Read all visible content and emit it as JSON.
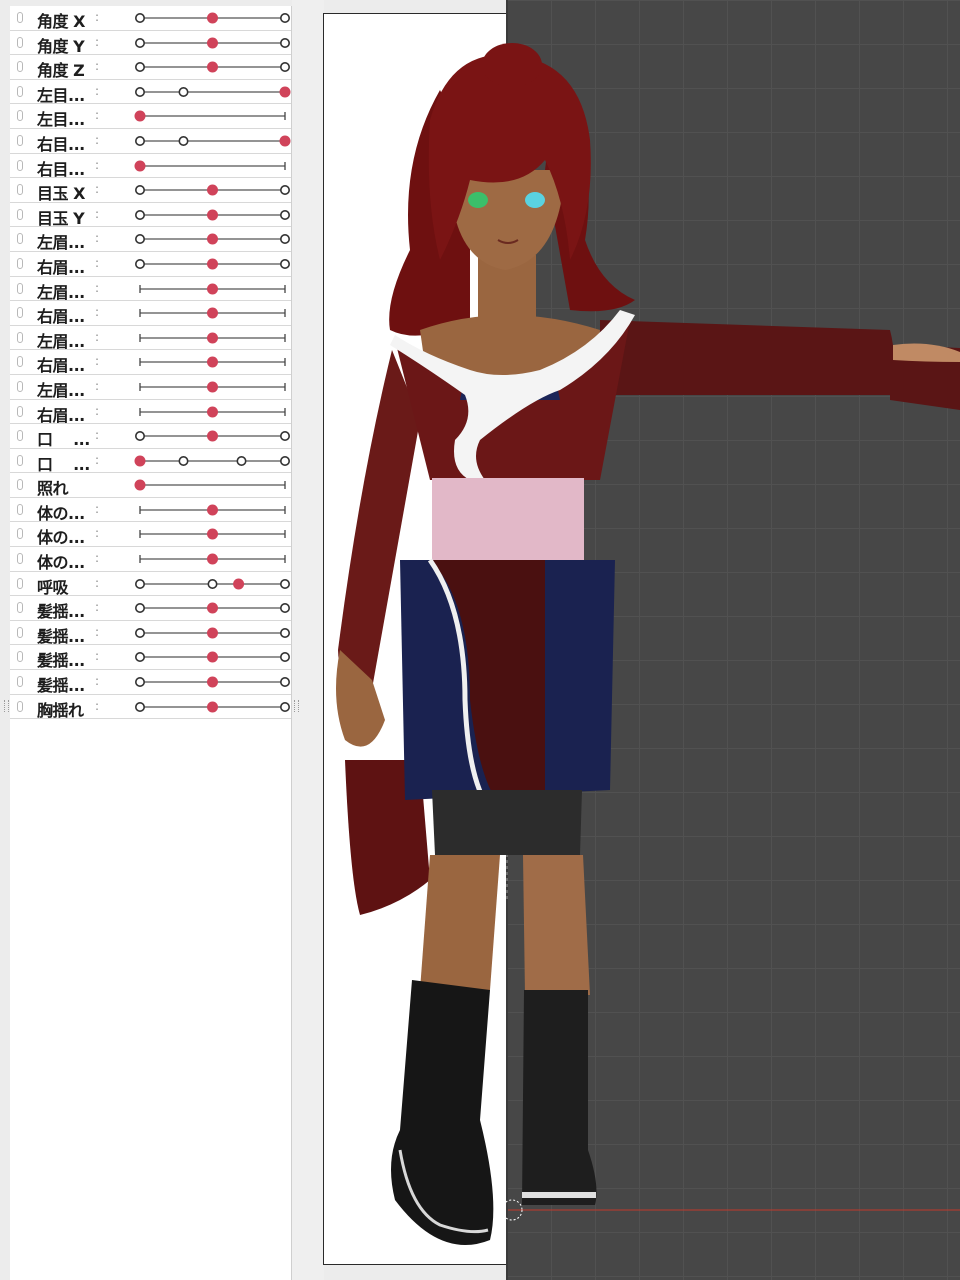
{
  "params": [
    {
      "name": "角度 X",
      "colon": ":",
      "style": "ends",
      "dots": [],
      "value": 0.5
    },
    {
      "name": "角度 Y",
      "colon": ":",
      "style": "ends",
      "dots": [],
      "value": 0.5
    },
    {
      "name": "角度 Z",
      "colon": ":",
      "style": "ends",
      "dots": [],
      "value": 0.5
    },
    {
      "name": "左目...",
      "colon": ":",
      "style": "ends",
      "dots": [
        0.3
      ],
      "value": 1.0
    },
    {
      "name": "左目...",
      "colon": ":",
      "style": "plain",
      "dots": [],
      "value": 0.0
    },
    {
      "name": "右目...",
      "colon": ":",
      "style": "ends",
      "dots": [
        0.3
      ],
      "value": 1.0
    },
    {
      "name": "右目...",
      "colon": ":",
      "style": "plain",
      "dots": [],
      "value": 0.0
    },
    {
      "name": "目玉 X",
      "colon": ":",
      "style": "ends",
      "dots": [],
      "value": 0.5
    },
    {
      "name": "目玉 Y",
      "colon": ":",
      "style": "ends",
      "dots": [],
      "value": 0.5
    },
    {
      "name": "左眉...",
      "colon": ":",
      "style": "ends",
      "dots": [],
      "value": 0.5
    },
    {
      "name": "右眉...",
      "colon": ":",
      "style": "ends",
      "dots": [],
      "value": 0.5
    },
    {
      "name": "左眉...",
      "colon": ":",
      "style": "plain",
      "dots": [],
      "value": 0.5
    },
    {
      "name": "右眉...",
      "colon": ":",
      "style": "plain",
      "dots": [],
      "value": 0.5
    },
    {
      "name": "左眉...",
      "colon": ":",
      "style": "plain",
      "dots": [],
      "value": 0.5
    },
    {
      "name": "右眉...",
      "colon": ":",
      "style": "plain",
      "dots": [],
      "value": 0.5
    },
    {
      "name": "左眉...",
      "colon": ":",
      "style": "plain",
      "dots": [],
      "value": 0.5
    },
    {
      "name": "右眉...",
      "colon": ":",
      "style": "plain",
      "dots": [],
      "value": 0.5
    },
    {
      "name": "口　 ...",
      "colon": ":",
      "style": "ends",
      "dots": [],
      "value": 0.5
    },
    {
      "name": "口　 ...",
      "colon": ":",
      "style": "ends",
      "dots": [
        0.3,
        0.7
      ],
      "value": 0.0
    },
    {
      "name": "照れ",
      "colon": "",
      "style": "plain",
      "dots": [],
      "value": 0.0
    },
    {
      "name": "体の...",
      "colon": ":",
      "style": "plain",
      "dots": [],
      "value": 0.5
    },
    {
      "name": "体の...",
      "colon": ":",
      "style": "plain",
      "dots": [],
      "value": 0.5
    },
    {
      "name": "体の...",
      "colon": ":",
      "style": "plain",
      "dots": [],
      "value": 0.5
    },
    {
      "name": "呼吸",
      "colon": ":",
      "style": "ends",
      "dots": [
        0.5
      ],
      "value": 0.68
    },
    {
      "name": "髪揺...",
      "colon": ":",
      "style": "ends",
      "dots": [],
      "value": 0.5
    },
    {
      "name": "髪揺...",
      "colon": ":",
      "style": "ends",
      "dots": [],
      "value": 0.5
    },
    {
      "name": "髪揺...",
      "colon": ":",
      "style": "ends",
      "dots": [],
      "value": 0.5
    },
    {
      "name": "髪揺...",
      "colon": ":",
      "style": "ends",
      "dots": [],
      "value": 0.5
    },
    {
      "name": "胸揺れ",
      "colon": ":",
      "style": "ends",
      "dots": [],
      "value": 0.5
    }
  ],
  "colors": {
    "knob": "#d0435a",
    "track": "#555555",
    "viewport_bg": "#474747",
    "grid": "#515151",
    "axis_line": "#c0392b",
    "hair": "#7a1414",
    "skin": "#9a6640",
    "robe": "#5a1515",
    "skirt": "#1a2250",
    "sash": "#e2b8c8",
    "boots": "#1a1a1a"
  }
}
